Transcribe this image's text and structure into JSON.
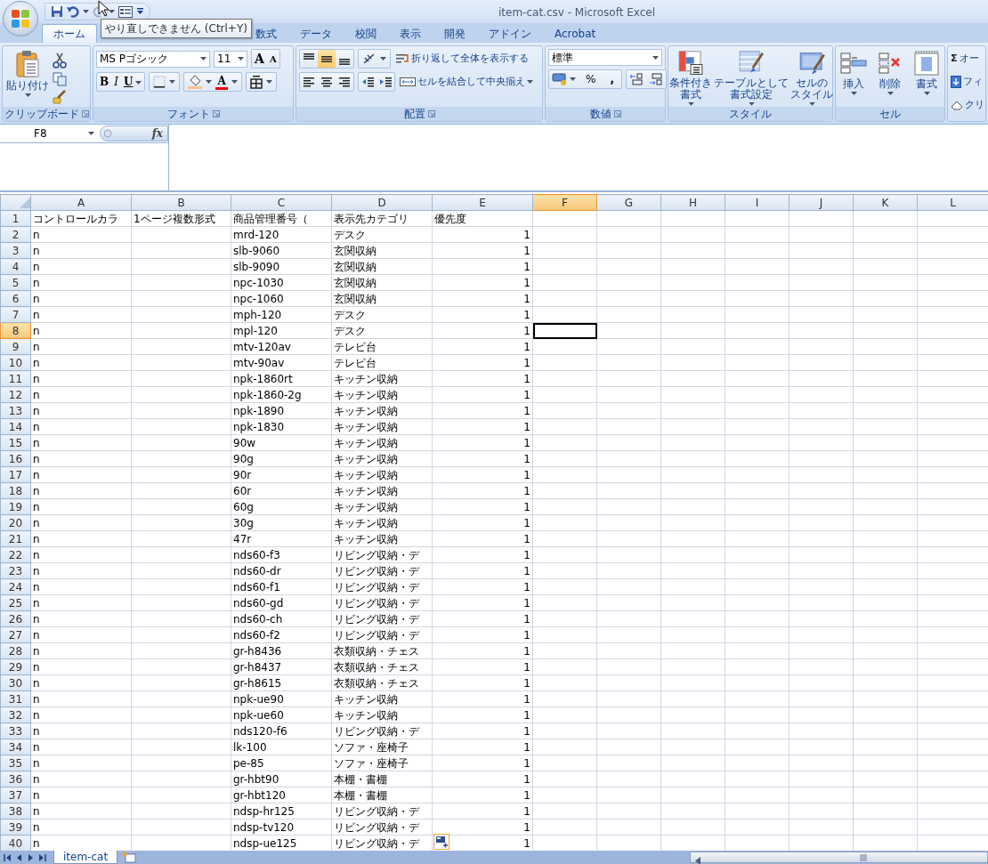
{
  "window": {
    "title": "item-cat.csv - Microsoft Excel"
  },
  "tooltip": {
    "text": "やり直しできません (Ctrl+Y)"
  },
  "ribbon_tabs": [
    {
      "label": "ホーム",
      "selected": true
    },
    {
      "label": "数式",
      "selected": false
    },
    {
      "label": "データ",
      "selected": false
    },
    {
      "label": "校閲",
      "selected": false
    },
    {
      "label": "表示",
      "selected": false
    },
    {
      "label": "開発",
      "selected": false
    },
    {
      "label": "アドイン",
      "selected": false
    },
    {
      "label": "Acrobat",
      "selected": false
    }
  ],
  "ribbon_groups": [
    {
      "kind": "clipboard",
      "label": "クリップボード",
      "paste": "貼り付け"
    },
    {
      "kind": "font",
      "label": "フォント",
      "font_name": "MS Pゴシック",
      "font_size": "11",
      "grow": "A",
      "shrink": "A",
      "styles": [
        "B",
        "I",
        "U"
      ],
      "font_color": "A"
    },
    {
      "kind": "alignment",
      "label": "配置",
      "vertical_align": [
        {
          "selected": false
        },
        {
          "selected": true
        },
        {
          "selected": false
        }
      ],
      "wrap": "折り返して全体を表示する",
      "merge": "セルを結合して中央揃え"
    },
    {
      "kind": "number",
      "label": "数値",
      "format": "標準",
      "percent": "%",
      "comma": ","
    },
    {
      "kind": "styles",
      "label": "スタイル",
      "buttons": [
        [
          "条件付き",
          "書式"
        ],
        [
          "テーブルとして",
          "書式設定"
        ],
        [
          "セルの",
          "スタイル"
        ]
      ]
    },
    {
      "kind": "cells",
      "label": "セル",
      "buttons": [
        "挿入",
        "削除",
        "書式"
      ]
    },
    {
      "kind": "editing",
      "sum_symbol": "Σ",
      "items": [
        "オー",
        "フィ",
        "クリ"
      ]
    }
  ],
  "formula_bar": {
    "name_box": "F8",
    "function_label": "fx"
  },
  "sheet": {
    "columns": [
      {
        "label": "A",
        "selected": false
      },
      {
        "label": "B",
        "selected": false
      },
      {
        "label": "C",
        "selected": false
      },
      {
        "label": "D",
        "selected": false
      },
      {
        "label": "E",
        "selected": false
      },
      {
        "label": "F",
        "selected": true
      },
      {
        "label": "G",
        "selected": false
      },
      {
        "label": "H",
        "selected": false
      },
      {
        "label": "I",
        "selected": false
      },
      {
        "label": "J",
        "selected": false
      },
      {
        "label": "K",
        "selected": false
      },
      {
        "label": "L",
        "selected": false
      }
    ],
    "rows": [
      {
        "number": "1",
        "selected": false,
        "kind": "heading",
        "cells": {
          "A": "コントロールカラ",
          "B": "1ページ複数形式",
          "C": "商品管理番号（",
          "D": "表示先カテゴリ",
          "E": "優先度"
        }
      },
      {
        "number": "2",
        "selected": false,
        "kind": "record",
        "cells": {
          "A": "n",
          "C": "mrd-120",
          "D": "デスク",
          "E": "1"
        }
      },
      {
        "number": "3",
        "selected": false,
        "kind": "record",
        "cells": {
          "A": "n",
          "C": "slb-9060",
          "D": "玄関収納",
          "E": "1"
        }
      },
      {
        "number": "4",
        "selected": false,
        "kind": "record",
        "cells": {
          "A": "n",
          "C": "slb-9090",
          "D": "玄関収納",
          "E": "1"
        }
      },
      {
        "number": "5",
        "selected": false,
        "kind": "record",
        "cells": {
          "A": "n",
          "C": "npc-1030",
          "D": "玄関収納",
          "E": "1"
        }
      },
      {
        "number": "6",
        "selected": false,
        "kind": "record",
        "cells": {
          "A": "n",
          "C": "npc-1060",
          "D": "玄関収納",
          "E": "1"
        }
      },
      {
        "number": "7",
        "selected": false,
        "kind": "record",
        "cells": {
          "A": "n",
          "C": "mph-120",
          "D": "デスク",
          "E": "1"
        }
      },
      {
        "number": "8",
        "selected": true,
        "kind": "record",
        "cells": {
          "A": "n",
          "C": "mpl-120",
          "D": "デスク",
          "E": "1"
        }
      },
      {
        "number": "9",
        "selected": false,
        "kind": "record",
        "cells": {
          "A": "n",
          "C": "mtv-120av",
          "D": "テレビ台",
          "E": "1"
        }
      },
      {
        "number": "10",
        "selected": false,
        "kind": "record",
        "cells": {
          "A": "n",
          "C": "mtv-90av",
          "D": "テレビ台",
          "E": "1"
        }
      },
      {
        "number": "11",
        "selected": false,
        "kind": "record",
        "cells": {
          "A": "n",
          "C": "npk-1860rt",
          "D": "キッチン収納",
          "E": "1"
        }
      },
      {
        "number": "12",
        "selected": false,
        "kind": "record",
        "cells": {
          "A": "n",
          "C": "npk-1860-2g",
          "D": "キッチン収納",
          "E": "1"
        }
      },
      {
        "number": "13",
        "selected": false,
        "kind": "record",
        "cells": {
          "A": "n",
          "C": "npk-1890",
          "D": "キッチン収納",
          "E": "1"
        }
      },
      {
        "number": "14",
        "selected": false,
        "kind": "record",
        "cells": {
          "A": "n",
          "C": "npk-1830",
          "D": "キッチン収納",
          "E": "1"
        }
      },
      {
        "number": "15",
        "selected": false,
        "kind": "record",
        "cells": {
          "A": "n",
          "C": "90w",
          "D": "キッチン収納",
          "E": "1"
        }
      },
      {
        "number": "16",
        "selected": false,
        "kind": "record",
        "cells": {
          "A": "n",
          "C": "90g",
          "D": "キッチン収納",
          "E": "1"
        }
      },
      {
        "number": "17",
        "selected": false,
        "kind": "record",
        "cells": {
          "A": "n",
          "C": "90r",
          "D": "キッチン収納",
          "E": "1"
        }
      },
      {
        "number": "18",
        "selected": false,
        "kind": "record",
        "cells": {
          "A": "n",
          "C": "60r",
          "D": "キッチン収納",
          "E": "1"
        }
      },
      {
        "number": "19",
        "selected": false,
        "kind": "record",
        "cells": {
          "A": "n",
          "C": "60g",
          "D": "キッチン収納",
          "E": "1"
        }
      },
      {
        "number": "20",
        "selected": false,
        "kind": "record",
        "cells": {
          "A": "n",
          "C": "30g",
          "D": "キッチン収納",
          "E": "1"
        }
      },
      {
        "number": "21",
        "selected": false,
        "kind": "record",
        "cells": {
          "A": "n",
          "C": "47r",
          "D": "キッチン収納",
          "E": "1"
        }
      },
      {
        "number": "22",
        "selected": false,
        "kind": "record",
        "cells": {
          "A": "n",
          "C": "nds60-f3",
          "D": "リビング収納・デ",
          "E": "1"
        }
      },
      {
        "number": "23",
        "selected": false,
        "kind": "record",
        "cells": {
          "A": "n",
          "C": "nds60-dr",
          "D": "リビング収納・デ",
          "E": "1"
        }
      },
      {
        "number": "24",
        "selected": false,
        "kind": "record",
        "cells": {
          "A": "n",
          "C": "nds60-f1",
          "D": "リビング収納・デ",
          "E": "1"
        }
      },
      {
        "number": "25",
        "selected": false,
        "kind": "record",
        "cells": {
          "A": "n",
          "C": "nds60-gd",
          "D": "リビング収納・デ",
          "E": "1"
        }
      },
      {
        "number": "26",
        "selected": false,
        "kind": "record",
        "cells": {
          "A": "n",
          "C": "nds60-ch",
          "D": "リビング収納・デ",
          "E": "1"
        }
      },
      {
        "number": "27",
        "selected": false,
        "kind": "record",
        "cells": {
          "A": "n",
          "C": "nds60-f2",
          "D": "リビング収納・デ",
          "E": "1"
        }
      },
      {
        "number": "28",
        "selected": false,
        "kind": "record",
        "cells": {
          "A": "n",
          "C": "gr-h8436",
          "D": "衣類収納・チェス",
          "E": "1"
        }
      },
      {
        "number": "29",
        "selected": false,
        "kind": "record",
        "cells": {
          "A": "n",
          "C": "gr-h8437",
          "D": "衣類収納・チェス",
          "E": "1"
        }
      },
      {
        "number": "30",
        "selected": false,
        "kind": "record",
        "cells": {
          "A": "n",
          "C": "gr-h8615",
          "D": "衣類収納・チェス",
          "E": "1"
        }
      },
      {
        "number": "31",
        "selected": false,
        "kind": "record",
        "cells": {
          "A": "n",
          "C": "npk-ue90",
          "D": "キッチン収納",
          "E": "1"
        }
      },
      {
        "number": "32",
        "selected": false,
        "kind": "record",
        "cells": {
          "A": "n",
          "C": "npk-ue60",
          "D": "キッチン収納",
          "E": "1"
        }
      },
      {
        "number": "33",
        "selected": false,
        "kind": "record",
        "cells": {
          "A": "n",
          "C": "nds120-f6",
          "D": "リビング収納・デ",
          "E": "1"
        }
      },
      {
        "number": "34",
        "selected": false,
        "kind": "record",
        "cells": {
          "A": "n",
          "C": "lk-100",
          "D": "ソファ・座椅子",
          "E": "1"
        }
      },
      {
        "number": "35",
        "selected": false,
        "kind": "record",
        "cells": {
          "A": "n",
          "C": "pe-85",
          "D": "ソファ・座椅子",
          "E": "1"
        }
      },
      {
        "number": "36",
        "selected": false,
        "kind": "record",
        "cells": {
          "A": "n",
          "C": "gr-hbt90",
          "D": "本棚・書棚",
          "E": "1"
        }
      },
      {
        "number": "37",
        "selected": false,
        "kind": "record",
        "cells": {
          "A": "n",
          "C": "gr-hbt120",
          "D": "本棚・書棚",
          "E": "1"
        }
      },
      {
        "number": "38",
        "selected": false,
        "kind": "record",
        "cells": {
          "A": "n",
          "C": "ndsp-hr125",
          "D": "リビング収納・デ",
          "E": "1"
        }
      },
      {
        "number": "39",
        "selected": false,
        "kind": "record",
        "cells": {
          "A": "n",
          "C": "ndsp-tv120",
          "D": "リビング収納・デ",
          "E": "1"
        }
      },
      {
        "number": "40",
        "selected": false,
        "kind": "record",
        "cells": {
          "A": "n",
          "C": "ndsp-ue125",
          "D": "リビング収納・デ",
          "E": "1"
        }
      }
    ]
  },
  "sheet_tabs": [
    {
      "label": "item-cat",
      "selected": true
    }
  ]
}
